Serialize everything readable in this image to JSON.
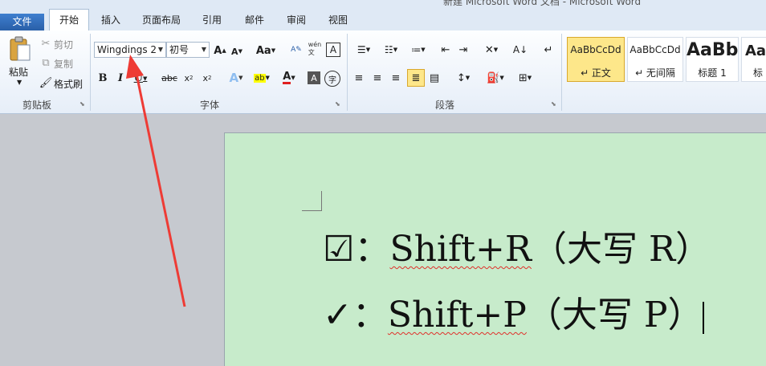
{
  "window": {
    "title": "新建 Microsoft Word 文档 - Microsoft Word"
  },
  "tabs": [
    "文件",
    "开始",
    "插入",
    "页面布局",
    "引用",
    "邮件",
    "审阅",
    "视图"
  ],
  "clipboard": {
    "paste": "粘贴",
    "cut": "剪切",
    "copy": "复制",
    "format_painter": "格式刷",
    "group": "剪贴板"
  },
  "font": {
    "family": "Wingdings 2",
    "size": "初号",
    "group": "字体",
    "change_case": "Aa"
  },
  "paragraph": {
    "group": "段落"
  },
  "styles": [
    {
      "sample": "AaBbCcDd",
      "name": "↵ 正文",
      "selected": true
    },
    {
      "sample": "AaBbCcDd",
      "name": "↵ 无间隔"
    },
    {
      "sample": "AaBb",
      "name": "标题 1"
    },
    {
      "sample": "Aa",
      "name": "标"
    }
  ],
  "document": {
    "line1": {
      "symbol": "☑",
      "colon": "：",
      "keys": "Shift+R",
      "note": "（大写 R）"
    },
    "line2": {
      "symbol": "✓",
      "colon": "：",
      "keys": "Shift+P",
      "note": "（大写 P）"
    }
  },
  "colors": {
    "file_tab": "#2b5fa8",
    "page_bg": "#c7ebcb",
    "arrow": "#ee3b35",
    "selected_style": "#fde78a"
  }
}
